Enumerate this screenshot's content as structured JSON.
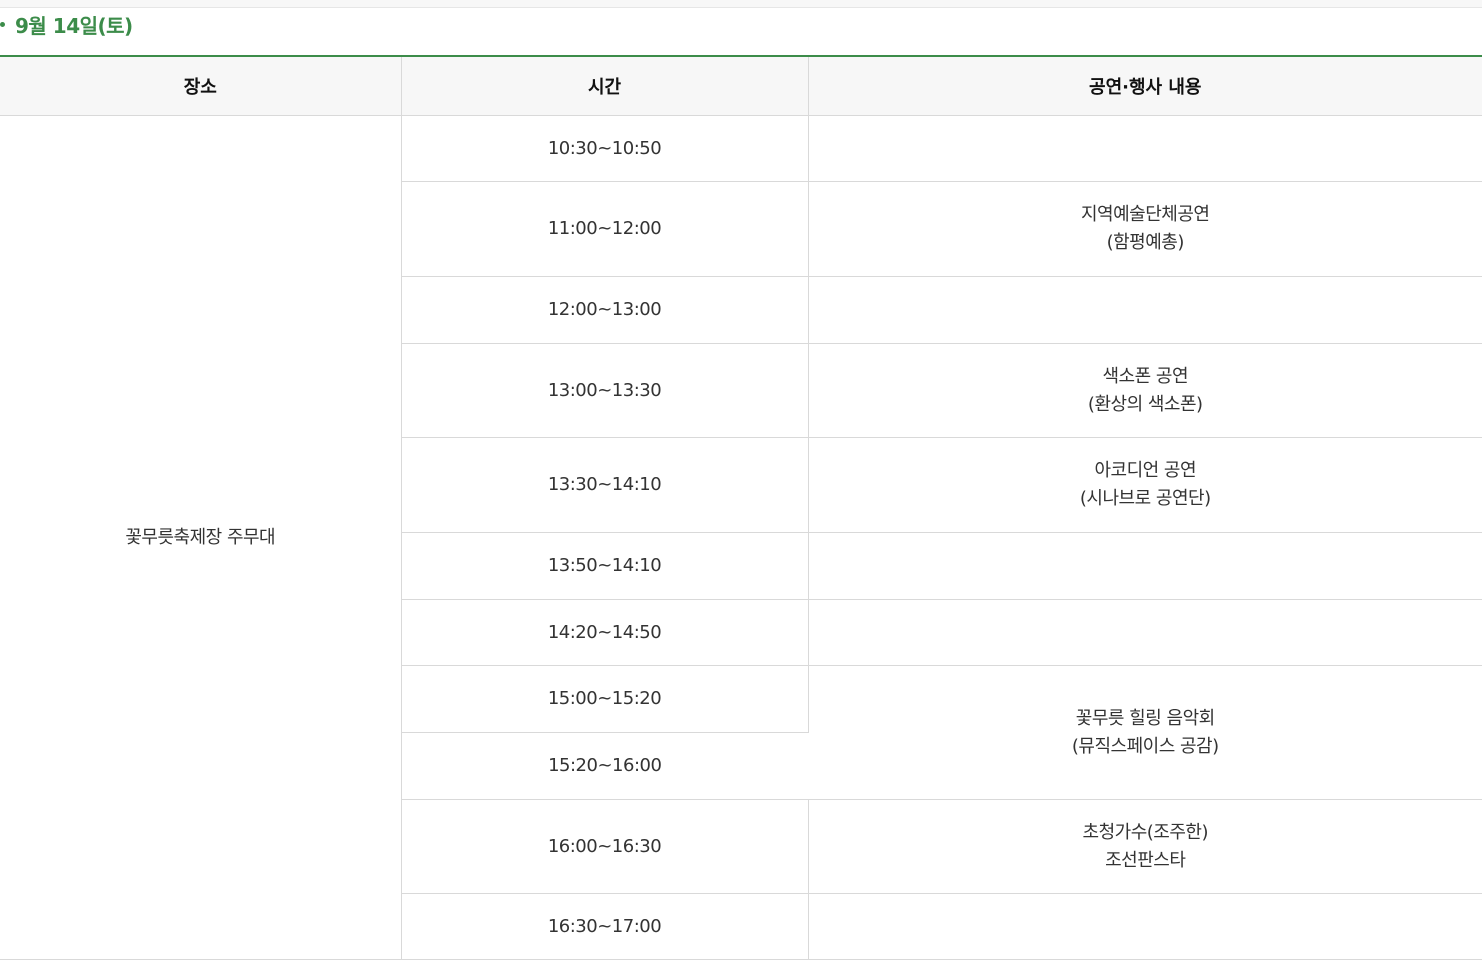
{
  "heading": {
    "date": "9월 14일(토)"
  },
  "table": {
    "headers": {
      "venue": "장소",
      "time": "시간",
      "event": "공연·행사 내용"
    },
    "venue": "꽃무릇축제장 주무대",
    "rows": [
      {
        "time": "10:30~10:50"
      },
      {
        "time": "11:00~12:00",
        "event_line1": "지역예술단체공연",
        "event_line2": "(함평예총)"
      },
      {
        "time": "12:00~13:00"
      },
      {
        "time": "13:00~13:30",
        "event_line1": "색소폰 공연",
        "event_line2": "(환상의 색소폰)"
      },
      {
        "time": "13:30~14:10",
        "event_line1": "아코디언 공연",
        "event_line2": "(시나브로 공연단)"
      },
      {
        "time": "13:50~14:10"
      },
      {
        "time": "14:20~14:50"
      },
      {
        "time": "15:00~15:20",
        "event_line1": "꽃무릇 힐링 음악회",
        "event_line2": "(뮤직스페이스 공감)"
      },
      {
        "time": "15:20~16:00"
      },
      {
        "time": "16:00~16:30",
        "event_line1": "초청가수(조주한)",
        "event_line2": "조선판스타"
      },
      {
        "time": "16:30~17:00"
      }
    ]
  },
  "colors": {
    "accent": "#3c8c4a",
    "header_bg": "#f7f7f7",
    "border": "#d9d9d9"
  }
}
